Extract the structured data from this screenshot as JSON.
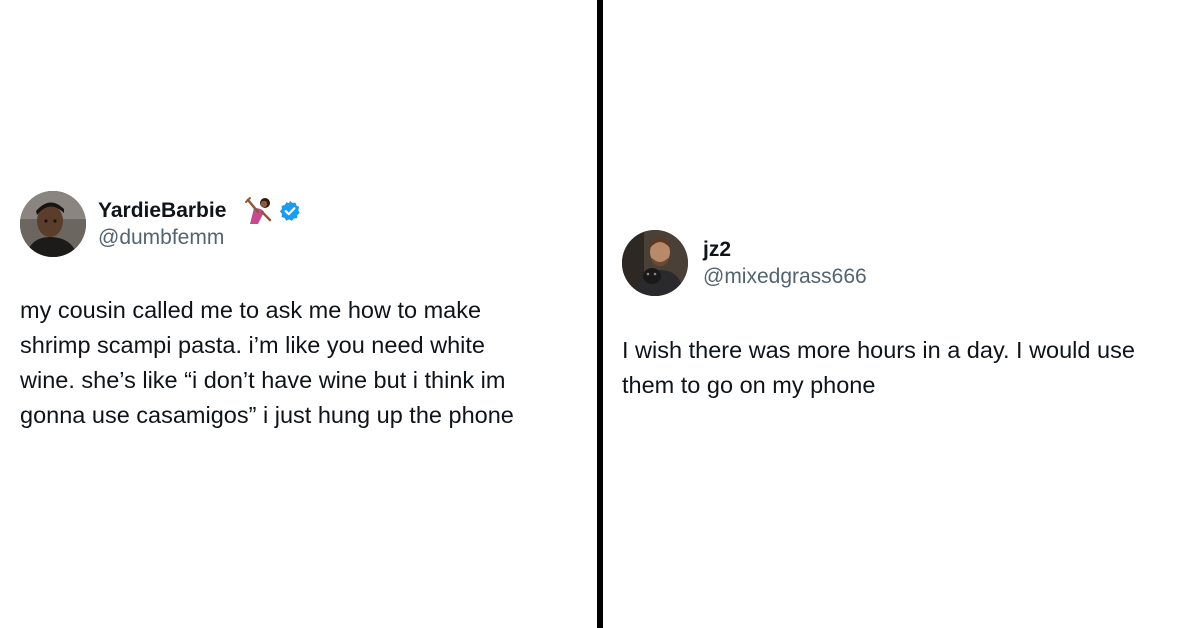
{
  "left_tweet": {
    "display_name": "YardieBarbie",
    "handle": "@dumbfemm",
    "verified": true,
    "badge_color": "#1d9bf0",
    "name_emoji_icon": "woman-dancing-emoji-icon",
    "text_lines": [
      "my cousin called me to ask me how to make",
      "shrimp scampi pasta. i’m like you need white",
      "wine. she’s like “i don’t have wine but i think im",
      "gonna use casamigos” i just hung up the phone"
    ]
  },
  "right_tweet": {
    "display_name": "jz2",
    "handle": "@mixedgrass666",
    "verified": false,
    "text_lines": [
      "I wish there was more hours in a day. I would use",
      "them to go on my phone"
    ]
  },
  "colors": {
    "text": "#0f1419",
    "handle": "#536471",
    "divider": "#000000",
    "background": "#ffffff"
  }
}
